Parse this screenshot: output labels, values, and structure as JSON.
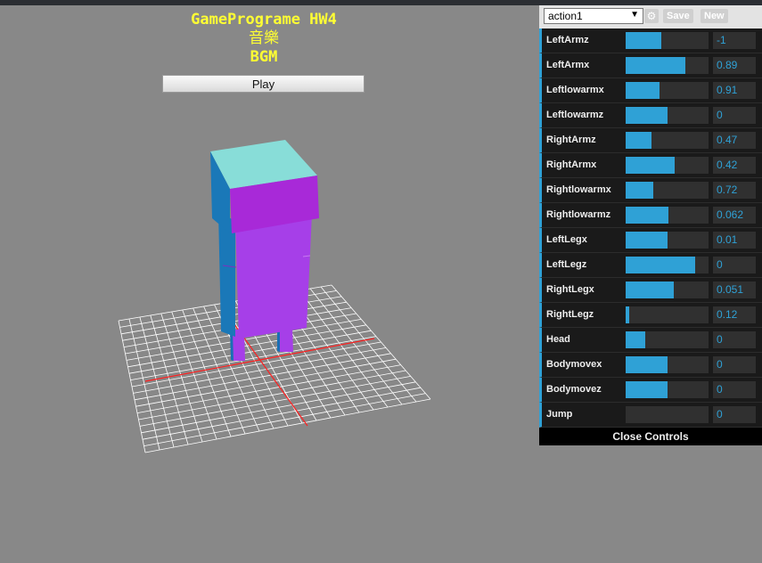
{
  "header": {
    "title": "GamePrograme HW4",
    "subtitle": "音樂",
    "bgm_label": "BGM",
    "play_label": "Play"
  },
  "gui": {
    "preset": "action1",
    "save_label": "Save",
    "new_label": "New",
    "close_label": "Close Controls",
    "accent_color": "#2fa1d6",
    "controllers": [
      {
        "label": "LeftArmz",
        "value": "-1",
        "fill": 0.43
      },
      {
        "label": "LeftArmx",
        "value": "0.89",
        "fill": 0.72
      },
      {
        "label": "Leftlowarmx",
        "value": "0.91",
        "fill": 0.41
      },
      {
        "label": "Leftlowarmz",
        "value": "0",
        "fill": 0.5
      },
      {
        "label": "RightArmz",
        "value": "0.47",
        "fill": 0.31
      },
      {
        "label": "RightArmx",
        "value": "0.42",
        "fill": 0.59
      },
      {
        "label": "Rightlowarmx",
        "value": "0.72",
        "fill": 0.33
      },
      {
        "label": "Rightlowarmz",
        "value": "0.062",
        "fill": 0.52
      },
      {
        "label": "LeftLegx",
        "value": "0.01",
        "fill": 0.51
      },
      {
        "label": "LeftLegz",
        "value": "0",
        "fill": 0.84
      },
      {
        "label": "RightLegx",
        "value": "0.051",
        "fill": 0.58
      },
      {
        "label": "RightLegz",
        "value": "0.12",
        "fill": 0.04
      },
      {
        "label": "Head",
        "value": "0",
        "fill": 0.24
      },
      {
        "label": "Bodymovex",
        "value": "0",
        "fill": 0.5
      },
      {
        "label": "Bodymovez",
        "value": "0",
        "fill": 0.5
      },
      {
        "label": "Jump",
        "value": "0",
        "fill": 0.0
      }
    ]
  }
}
